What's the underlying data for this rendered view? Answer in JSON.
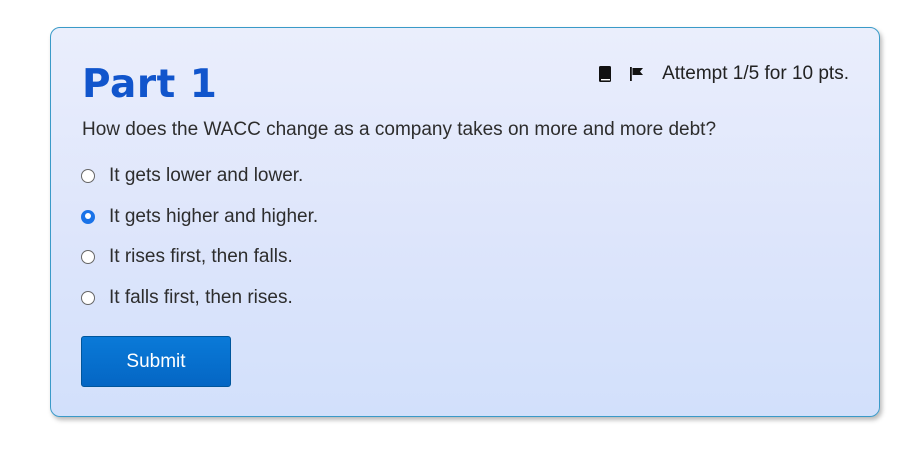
{
  "part": {
    "title": "Part 1",
    "attempt_text": "Attempt 1/5 for 10 pts."
  },
  "icons": {
    "book": "book-icon",
    "flag": "flag-icon"
  },
  "question": {
    "text": "How does the WACC change as a company takes on more and more debt?",
    "options": [
      {
        "label": "It gets lower and lower.",
        "selected": false
      },
      {
        "label": "It gets higher and higher.",
        "selected": true
      },
      {
        "label": "It rises first, then falls.",
        "selected": false
      },
      {
        "label": "It falls first, then rises.",
        "selected": false
      }
    ]
  },
  "actions": {
    "submit_label": "Submit"
  },
  "colors": {
    "title": "#1155cc",
    "accent": "#1a73e8",
    "button": "#0466c4",
    "card_border": "#3a9ac8"
  }
}
